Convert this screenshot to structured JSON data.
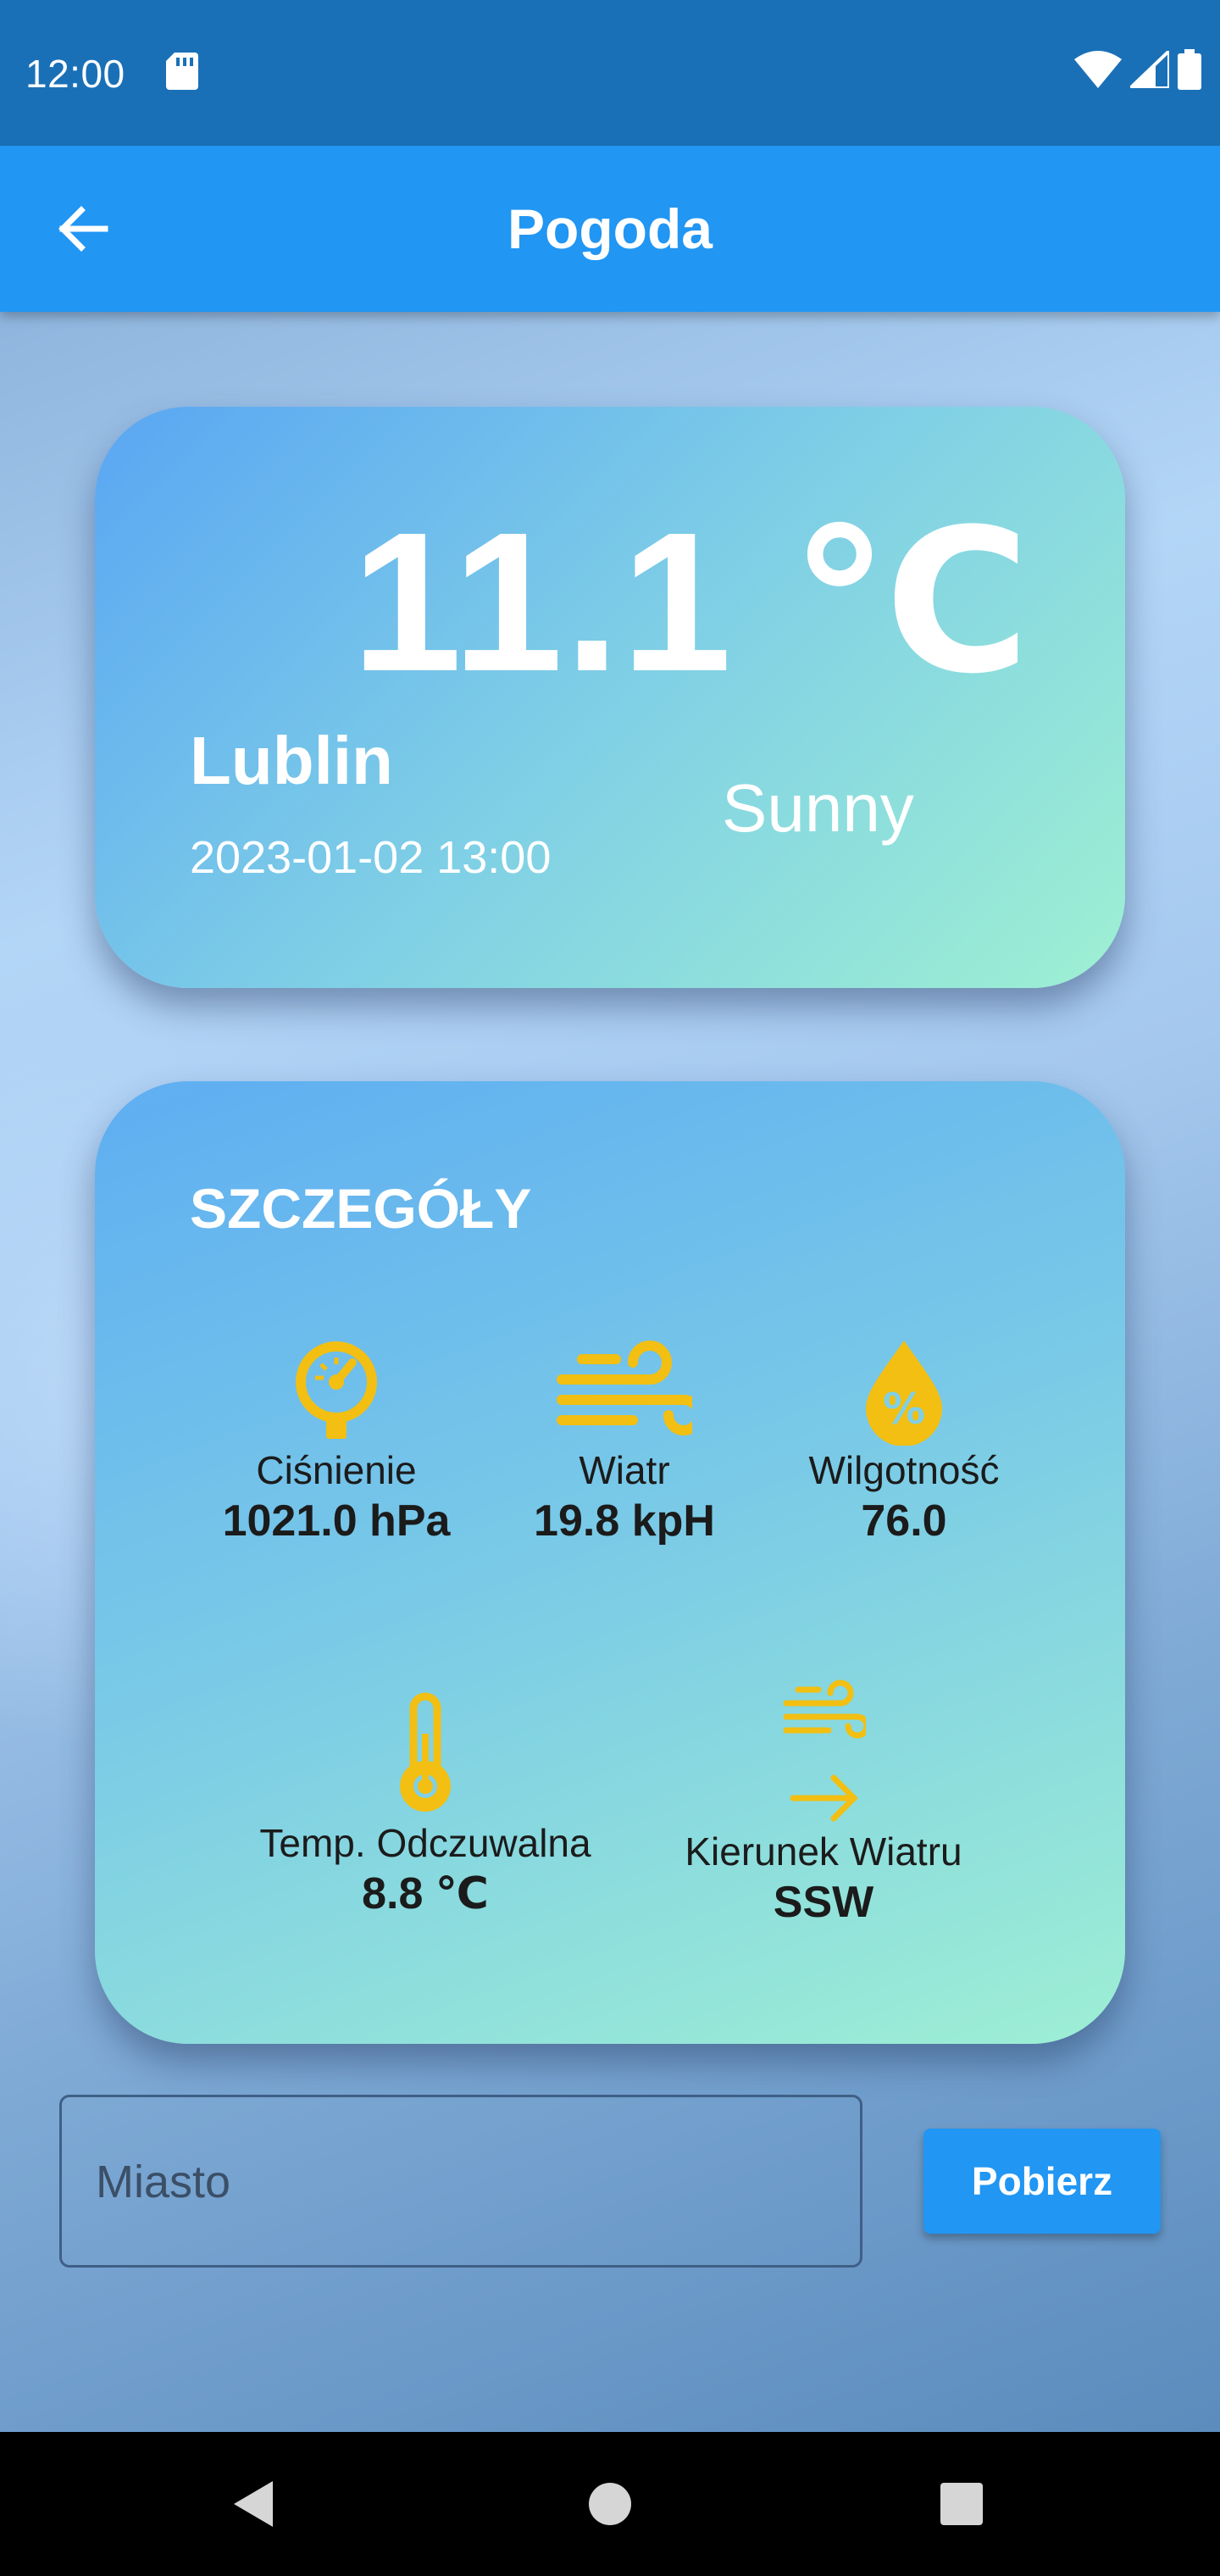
{
  "status_bar": {
    "time": "12:00",
    "icons": [
      "sd-card-icon",
      "wifi-icon",
      "signal-icon",
      "battery-icon"
    ]
  },
  "app_bar": {
    "title": "Pogoda",
    "back_icon": "arrow-back-icon"
  },
  "weather": {
    "temperature": "11.1 ℃",
    "city": "Lublin",
    "datetime": "2023-01-02 13:00",
    "condition": "Sunny"
  },
  "details": {
    "title": "SZCZEGÓŁY",
    "pressure": {
      "label": "Ciśnienie",
      "value": "1021.0 hPa",
      "icon": "gauge-icon"
    },
    "wind": {
      "label": "Wiatr",
      "value": "19.8 kpH",
      "icon": "wind-icon"
    },
    "humidity": {
      "label": "Wilgotność",
      "value": "76.0",
      "icon": "humidity-drop-icon"
    },
    "feels_like": {
      "label": "Temp. Odczuwalna",
      "value": "8.8 ℃",
      "icon": "thermometer-icon"
    },
    "wind_direction": {
      "label": "Kierunek Wiatru",
      "value": "SSW",
      "icon": "wind-direction-icon"
    }
  },
  "search": {
    "placeholder": "Miasto",
    "button_label": "Pobierz"
  },
  "colors": {
    "status_bar": "#1a70b7",
    "app_bar": "#2196f3",
    "icon_accent": "#f2bf12",
    "button": "#2196f3"
  },
  "nav_bar": {
    "icons": [
      "nav-back-icon",
      "nav-home-icon",
      "nav-recents-icon"
    ]
  }
}
